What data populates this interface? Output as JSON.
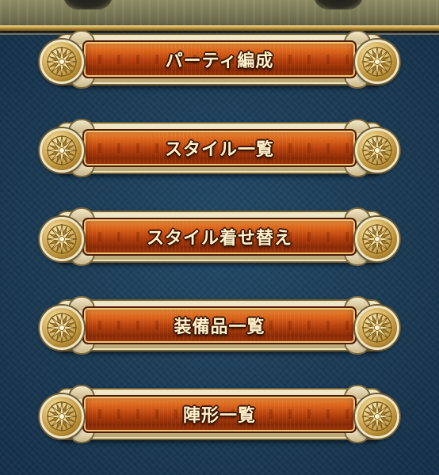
{
  "menu": {
    "items": [
      {
        "label": "パーティ編成"
      },
      {
        "label": "スタイル一覧"
      },
      {
        "label": "スタイル着せ替え"
      },
      {
        "label": "装備品一覧"
      },
      {
        "label": "陣形一覧"
      }
    ]
  },
  "colors": {
    "background": "#1c3d57",
    "button_plate": "#c24e12",
    "button_frame": "#e2d5ae",
    "label_text": "#fff3cd",
    "medallion_gold": "#d8b565"
  },
  "icons": {
    "medallion": "compass-star-icon"
  }
}
